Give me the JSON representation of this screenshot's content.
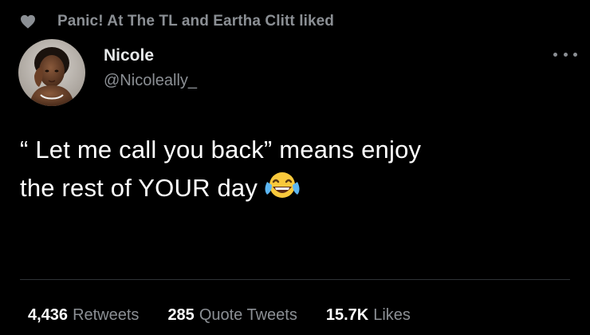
{
  "social_context": {
    "icon": "heart-icon",
    "text": "Panic! At The TL and Eartha Clitt liked"
  },
  "author": {
    "name": "Nicole",
    "handle": "@Nicoleally_"
  },
  "more_menu": {
    "icon": "more-icon"
  },
  "tweet": {
    "line1": "“ Let me call you back” means enjoy",
    "line2": "the rest of YOUR day",
    "emoji": "face-with-tears-of-joy"
  },
  "stats": [
    {
      "value": "4,436",
      "label": "Retweets"
    },
    {
      "value": "285",
      "label": "Quote Tweets"
    },
    {
      "value": "15.7K",
      "label": "Likes"
    }
  ],
  "colors": {
    "background": "#000000",
    "text": "#ffffff",
    "secondary": "#8b8f94",
    "divider": "#2f3336",
    "heart": "#8b8f94"
  }
}
